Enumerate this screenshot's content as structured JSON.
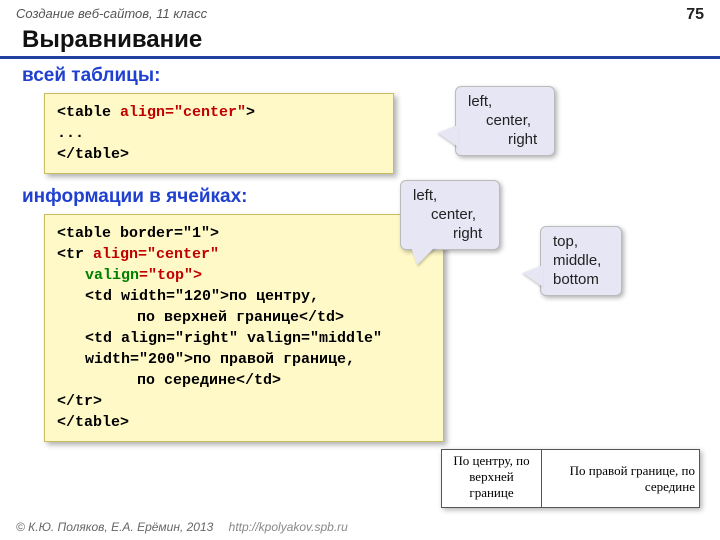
{
  "header": {
    "course": "Создание веб-сайтов, 11 класс",
    "pagenum": "75"
  },
  "title": "Выравнивание",
  "section1": "всей таблицы:",
  "section2": "информации в ячейках:",
  "code1": {
    "l1a": "<table ",
    "l1b": "align=\"center\"",
    "l1c": ">",
    "l2": "...",
    "l3": "</table>"
  },
  "code2": {
    "l1": "<table border=\"1\">",
    "l2a": "<tr ",
    "l2b": "align=\"center\"",
    "l3a": "valign",
    "l3b": "=\"top\">",
    "l4": "<td width=\"120\">по центру,",
    "l5": "по верхней границе</td>",
    "l6": "<td align=\"right\" valign=\"middle\"",
    "l7": "width=\"200\">по правой границе,",
    "l8": "по середине</td>",
    "l9": "</tr>",
    "l10": "</table>"
  },
  "callout_h": {
    "l1": "left,",
    "l2": "center,",
    "l3": "right"
  },
  "callout_v": {
    "l1": "top,",
    "l2": "middle,",
    "l3": "bottom"
  },
  "example": {
    "cell1": "По центру, по верхней границе",
    "cell2": "По правой границе, по середине"
  },
  "footer": {
    "copyright": "© К.Ю. Поляков, Е.А. Ерёмин, 2013",
    "url": "http://kpolyakov.spb.ru"
  }
}
